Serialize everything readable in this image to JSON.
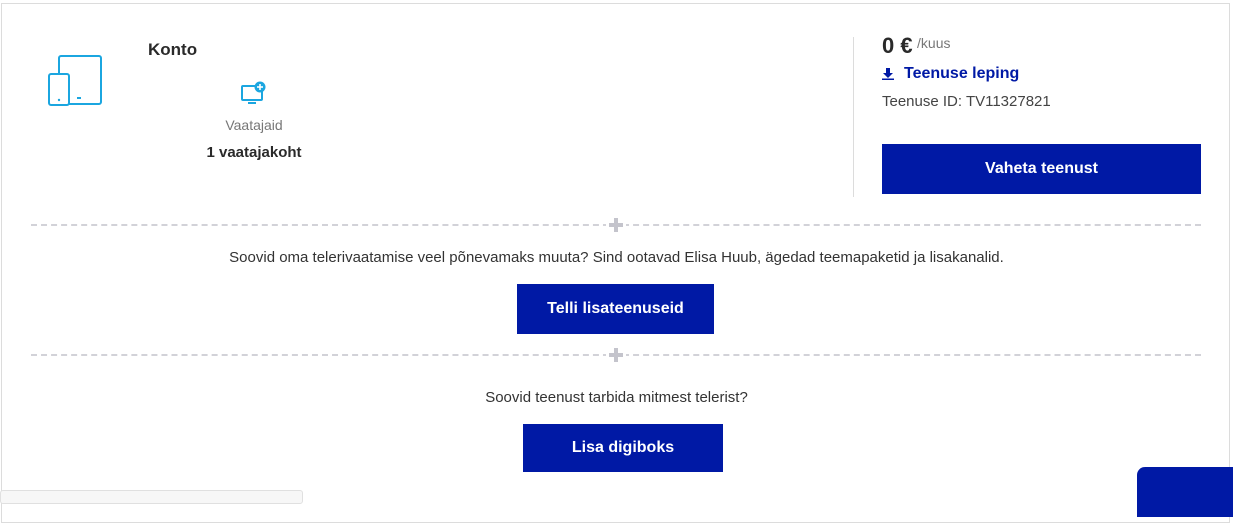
{
  "account": {
    "title": "Konto",
    "viewers_label": "Vaatajaid",
    "viewers_value": "1 vaatajakoht"
  },
  "pricing": {
    "amount": "0 €",
    "period": "/kuus",
    "contract_link": "Teenuse leping",
    "service_id": "Teenuse ID: TV11327821",
    "change_button": "Vaheta teenust"
  },
  "promo_extra": {
    "text": "Soovid oma telerivaatamise veel põnevamaks muuta? Sind ootavad Elisa Huub, ägedad teemapaketid ja lisakanalid.",
    "button": "Telli lisateenuseid"
  },
  "promo_multi_tv": {
    "text": "Soovid teenust tarbida mitmest telerist?",
    "button": "Lisa digiboks"
  },
  "colors": {
    "accent": "#0019a5",
    "icon_cyan": "#1ba6e0",
    "divider": "#d2d2d8"
  },
  "icons": {
    "devices": "tablet-phone-icon",
    "add_viewer": "tv-add-icon",
    "download": "download-icon",
    "separator": "plus-icon"
  }
}
